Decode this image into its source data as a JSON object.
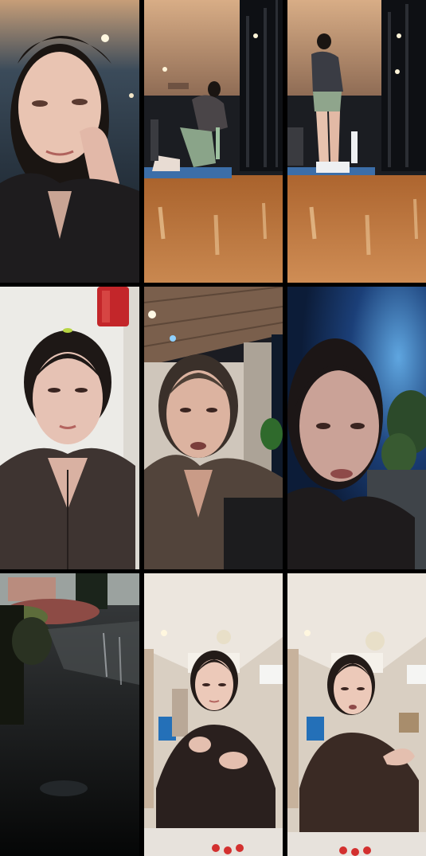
{
  "collage": {
    "rows": 3,
    "columns": 3,
    "tiles": [
      {
        "scene": "selfie-gym-closeup",
        "palette": {
          "bg": "#1d2b3a",
          "skin": "#e9c4b2",
          "hair": "#1a1512",
          "jacket": "#1e1c1e"
        }
      },
      {
        "scene": "gym-kneeling-wide",
        "palette": {
          "ceiling": "#c9a07b",
          "floor": "#b06a33",
          "mat": "#3c6ea8",
          "machine": "#14161a"
        }
      },
      {
        "scene": "gym-standing-wide",
        "palette": {
          "ceiling": "#c9a07b",
          "floor": "#b67036",
          "machine": "#14161a",
          "shorts": "#8fa58c"
        }
      },
      {
        "scene": "selfie-white-wall",
        "palette": {
          "bg": "#ecebe7",
          "extinguisher": "#c3262a",
          "skin": "#e6c2b4",
          "jacket": "#3e3431"
        }
      },
      {
        "scene": "selfie-outdoor-night",
        "palette": {
          "roof": "#7a5f4c",
          "wall": "#cfc6bb",
          "skin": "#dcb3a0",
          "jacket": "#52443b"
        }
      },
      {
        "scene": "selfie-night-blue",
        "palette": {
          "sky": "#1b3f78",
          "trees": "#2c4a2a",
          "skin": "#caa297",
          "jacket": "#1e1b1c"
        }
      },
      {
        "scene": "rainy-street-night",
        "palette": {
          "road": "#2d2f31",
          "bushes": "#8d4b45",
          "sky": "#9ba29f"
        }
      },
      {
        "scene": "selfie-living-room",
        "palette": {
          "ceiling": "#ece6de",
          "wall": "#d9cfc2",
          "skin": "#ecc9b9",
          "jacket": "#2a201e"
        }
      },
      {
        "scene": "selfie-living-room-2",
        "palette": {
          "ceiling": "#ece6de",
          "wall": "#d9cfc2",
          "skin": "#ecc9b9",
          "jacket": "#3a2a24"
        }
      }
    ]
  }
}
